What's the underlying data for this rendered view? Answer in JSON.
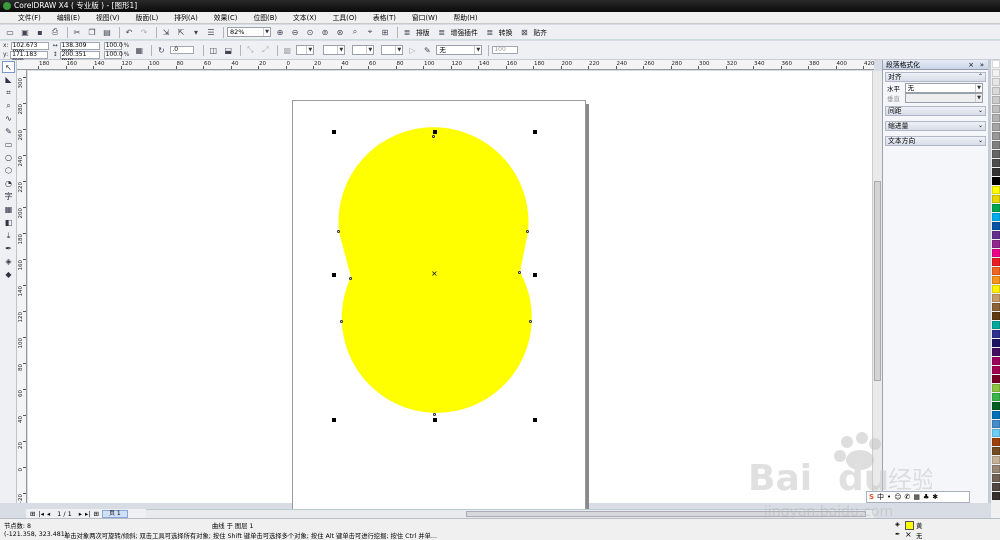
{
  "window": {
    "title": "CorelDRAW X4 ( 专业版 ) - [图形1]"
  },
  "menu": [
    "文件(F)",
    "编辑(E)",
    "视图(V)",
    "版面(L)",
    "排列(A)",
    "效果(C)",
    "位图(B)",
    "文本(X)",
    "工具(O)",
    "表格(T)",
    "窗口(W)",
    "帮助(H)"
  ],
  "toolbar": {
    "zoom": "82%",
    "buttons": {
      "paragraph": "排版",
      "enhance": "增强插件",
      "convert": "转换",
      "paste": "贴齐"
    }
  },
  "propbar": {
    "x": "102.673 mm",
    "y": "171.183 mm",
    "width": "138.309 mm",
    "height": "200.351 mm",
    "scale_x": "100.0",
    "scale_y": "100.0",
    "percent": "%",
    "rotation": ".0",
    "outline": "无",
    "outline_size": "100"
  },
  "ruler": {
    "h": [
      "180",
      "160",
      "140",
      "120",
      "100",
      "80",
      "60",
      "40",
      "20",
      "0",
      "20",
      "40",
      "60",
      "80",
      "100",
      "120",
      "140",
      "160",
      "180",
      "200",
      "220",
      "240",
      "260",
      "280",
      "300",
      "320",
      "340",
      "360",
      "380",
      "400",
      "420"
    ],
    "v": [
      "300",
      "280",
      "260",
      "240",
      "220",
      "200",
      "180",
      "160",
      "140",
      "120",
      "100",
      "80",
      "60",
      "40",
      "20",
      "0",
      "-20"
    ]
  },
  "tools": [
    "pick",
    "shape",
    "crop",
    "zoom",
    "freehand",
    "smart-fill",
    "rectangle",
    "ellipse",
    "polygon",
    "basic-shapes",
    "text",
    "table",
    "interactive",
    "eyedropper",
    "outline",
    "fill",
    "interactive-fill"
  ],
  "docker": {
    "title": "段落格式化",
    "align": "对齐",
    "horizontal": "水平",
    "horizontal_value": "无",
    "vertical": "垂直",
    "spacing": "间距",
    "indent": "缩进量",
    "direction": "文本方向"
  },
  "page_nav": {
    "count": "1 / 1",
    "tab": "页 1"
  },
  "status": {
    "nodes": "节点数: 8",
    "object": "曲线 于 图层 1",
    "coords": "(-121.358, 323.481)",
    "hint": "单击对象两次可旋转/倾斜; 双击工具可选择所有对象; 按住 Shift 键单击可选择多个对象; 按住 Alt 键单击可进行挖掘; 按住 Ctrl 并单...",
    "fill_name": "黄",
    "outline_name": "无"
  },
  "colors": {
    "shape_fill": "#ffff00",
    "palette": [
      "#ffffff",
      "#f2f2f2",
      "#e6e6e6",
      "#d9d9d9",
      "#cccccc",
      "#bfbfbf",
      "#b3b3b3",
      "#a6a6a6",
      "#999999",
      "#808080",
      "#666666",
      "#4d4d4d",
      "#333333",
      "#000000",
      "#ffff00",
      "#e6d800",
      "#00a651",
      "#00aeef",
      "#0054a6",
      "#662d91",
      "#92278f",
      "#ec008c",
      "#ed1c24",
      "#f26522",
      "#f7941d",
      "#fff200",
      "#c69c6d",
      "#8c6239",
      "#603913",
      "#00a99d",
      "#2e3192",
      "#1b1464",
      "#440e62",
      "#9e005d",
      "#a3004f",
      "#7a0026",
      "#8dc63f",
      "#39b54a",
      "#005e20",
      "#0072bc",
      "#448ccb",
      "#6dcff6",
      "#a0410d",
      "#754c24",
      "#c7b299",
      "#998675",
      "#736357",
      "#534741",
      "#362f2d"
    ]
  }
}
